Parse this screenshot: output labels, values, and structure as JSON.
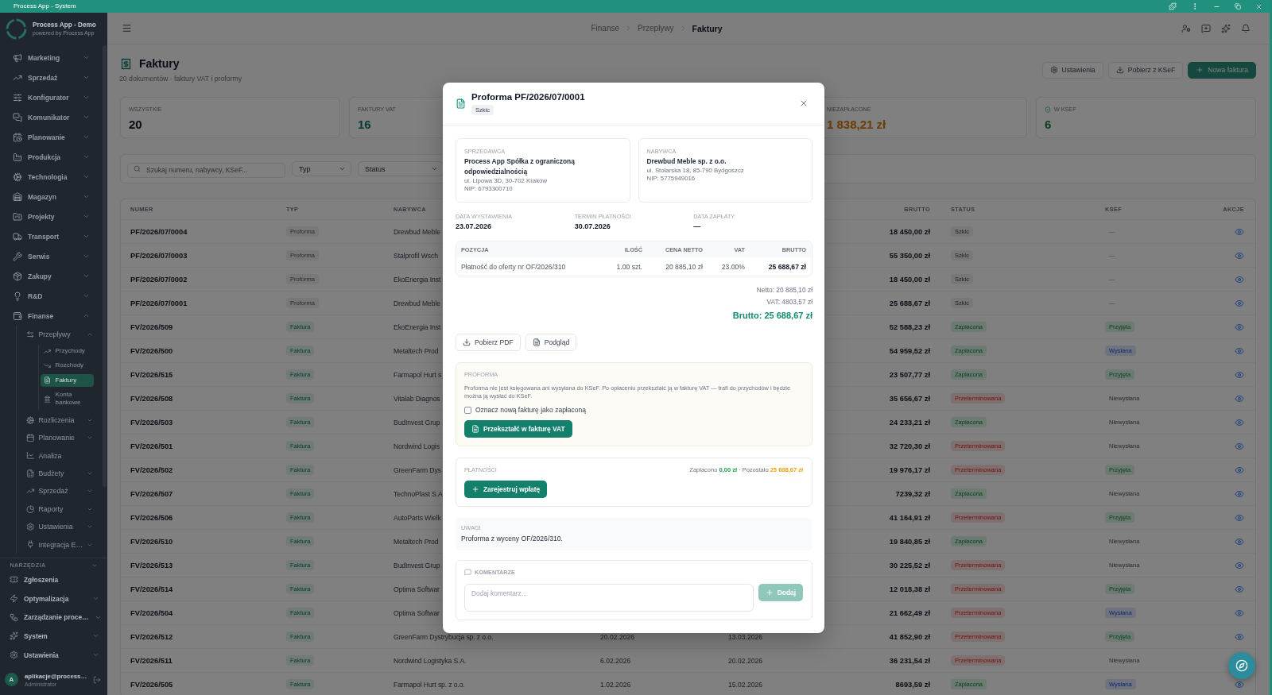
{
  "window": {
    "title": "Process App - System"
  },
  "sidebar": {
    "app_name": "Process App - Demo",
    "app_tagline": "powered by Process App",
    "items": [
      {
        "label": "Marketing",
        "expanded": false,
        "selected": false
      },
      {
        "label": "Sprzedaż",
        "expanded": false,
        "selected": false
      },
      {
        "label": "Konfigurator",
        "expanded": false,
        "selected": false
      },
      {
        "label": "Komunikator",
        "expanded": false,
        "selected": false
      },
      {
        "label": "Planowanie",
        "expanded": false,
        "selected": false
      },
      {
        "label": "Produkcja",
        "expanded": false,
        "selected": false
      },
      {
        "label": "Technologia",
        "expanded": false,
        "selected": false
      },
      {
        "label": "Magazyn",
        "expanded": false,
        "selected": false
      },
      {
        "label": "Projekty",
        "expanded": false,
        "selected": false
      },
      {
        "label": "Transport",
        "expanded": false,
        "selected": false
      },
      {
        "label": "Serwis",
        "expanded": false,
        "selected": false
      },
      {
        "label": "Zakupy",
        "expanded": false,
        "selected": false
      },
      {
        "label": "R&D",
        "expanded": false,
        "selected": false
      },
      {
        "label": "Finanse",
        "expanded": true,
        "selected": false,
        "children": [
          {
            "label": "Przepływy",
            "expanded": true,
            "selected": false,
            "children": [
              {
                "label": "Przychody",
                "selected": false
              },
              {
                "label": "Rozchody",
                "selected": false
              },
              {
                "label": "Faktury",
                "selected": true
              },
              {
                "label": "Konta bankowe",
                "selected": false
              }
            ]
          },
          {
            "label": "Rozliczenia",
            "expanded": false,
            "selected": false
          },
          {
            "label": "Planowanie",
            "expanded": false,
            "selected": false
          },
          {
            "label": "Analiza",
            "selected": false
          },
          {
            "label": "Budżety",
            "expanded": false,
            "selected": false
          },
          {
            "label": "Sprzedaż",
            "expanded": false,
            "selected": false
          },
          {
            "label": "Raporty",
            "expanded": false,
            "selected": false
          },
          {
            "label": "Ustawienia",
            "expanded": false,
            "selected": false
          },
          {
            "label": "Integracja E…",
            "expanded": false,
            "selected": false
          }
        ]
      }
    ],
    "tools": {
      "title": "NARZĘDZIA",
      "expanded": true,
      "items": [
        {
          "label": "Zgłoszenia",
          "selected": false
        },
        {
          "label": "Optymalizacja",
          "expanded": false,
          "selected": false
        },
        {
          "label": "Zarządzanie proce…",
          "expanded": false,
          "selected": false
        },
        {
          "label": "System",
          "expanded": false,
          "selected": false
        },
        {
          "label": "Ustawienia",
          "expanded": false,
          "selected": false
        }
      ]
    },
    "user": {
      "initial": "A",
      "name": "aplikacje@process…",
      "role": "Administrator"
    }
  },
  "topbar": {
    "breadcrumb": [
      {
        "label": "Finanse",
        "current": false
      },
      {
        "label": "Przepływy",
        "current": false
      },
      {
        "label": "Faktury",
        "current": true
      }
    ]
  },
  "page": {
    "title": "Faktury",
    "subtitle": "20 dokumentów · faktury VAT i proformy",
    "actions": [
      {
        "label": "Ustawienia",
        "kind": "settings"
      },
      {
        "label": "Pobierz z KSeF",
        "kind": "download"
      },
      {
        "label": "Nowa faktura",
        "kind": "primary"
      }
    ]
  },
  "stats": [
    {
      "label": "WSZYSTKIE",
      "value": "20",
      "kind": "total"
    },
    {
      "label": "FAKTURY VAT",
      "value": "16",
      "kind": "vat"
    },
    {
      "label": "NIEZAPŁACONE",
      "value": "1 838,21 zł",
      "kind": "unpaid"
    },
    {
      "label": "W KSEF",
      "value": "6",
      "kind": "ksef"
    }
  ],
  "filters": {
    "search": {
      "placeholder": "Szukaj numeru, nabywcy, KSeF..."
    },
    "selects": [
      {
        "value": "Typ"
      },
      {
        "value": "Status"
      }
    ]
  },
  "table": {
    "columns": [
      "NUMER",
      "TYP",
      "NABYWCA",
      "BRUTTO",
      "STATUS",
      "KSEF",
      "AKCJE"
    ],
    "rows": [
      {
        "numer": "PF/2026/07/0004",
        "typ": {
          "label": "Proforma",
          "kind": "proforma"
        },
        "nabywca": "Drewbud Meble",
        "brutto": "18 450,00 zł",
        "status": {
          "label": "Szkic",
          "kind": "draft"
        },
        "ksef": {
          "label": "—",
          "kind": "none"
        }
      },
      {
        "numer": "PF/2026/07/0003",
        "typ": {
          "label": "Proforma",
          "kind": "proforma"
        },
        "nabywca": "Stalprofil Wsch",
        "brutto": "55 350,00 zł",
        "status": {
          "label": "Szkic",
          "kind": "draft"
        },
        "ksef": {
          "label": "—",
          "kind": "none"
        }
      },
      {
        "numer": "PF/2026/07/0002",
        "typ": {
          "label": "Proforma",
          "kind": "proforma"
        },
        "nabywca": "EkoEnergia Inst",
        "brutto": "18 450,00 zł",
        "status": {
          "label": "Szkic",
          "kind": "draft"
        },
        "ksef": {
          "label": "—",
          "kind": "none"
        }
      },
      {
        "numer": "PF/2026/07/0001",
        "typ": {
          "label": "Proforma",
          "kind": "proforma"
        },
        "nabywca": "Drewbud Meble",
        "brutto": "25 688,67 zł",
        "status": {
          "label": "Szkic",
          "kind": "draft"
        },
        "ksef": {
          "label": "—",
          "kind": "none"
        }
      },
      {
        "numer": "FV/2026/509",
        "typ": {
          "label": "Faktura",
          "kind": "invoice"
        },
        "nabywca": "EkoEnergia Inst",
        "brutto": "52 588,23 zł",
        "status": {
          "label": "Zapłacona",
          "kind": "paid"
        },
        "ksef": {
          "label": "Przyjęta",
          "kind": "accepted"
        }
      },
      {
        "numer": "FV/2026/500",
        "typ": {
          "label": "Faktura",
          "kind": "invoice"
        },
        "nabywca": "Metaltech Prod",
        "brutto": "54 959,52 zł",
        "status": {
          "label": "Zapłacona",
          "kind": "paid"
        },
        "ksef": {
          "label": "Wysłana",
          "kind": "sent"
        }
      },
      {
        "numer": "FV/2026/515",
        "typ": {
          "label": "Faktura",
          "kind": "invoice"
        },
        "nabywca": "Farmapol Hurt s",
        "brutto": "23 507,77 zł",
        "status": {
          "label": "Zapłacona",
          "kind": "paid"
        },
        "ksef": {
          "label": "Przyjęta",
          "kind": "accepted"
        }
      },
      {
        "numer": "FV/2026/508",
        "typ": {
          "label": "Faktura",
          "kind": "invoice"
        },
        "nabywca": "Vitalab Diagnos",
        "brutto": "35 656,67 zł",
        "status": {
          "label": "Przeterminowana",
          "kind": "overdue"
        },
        "ksef": {
          "label": "Niewysłana",
          "kind": "not_sent"
        }
      },
      {
        "numer": "FV/2026/503",
        "typ": {
          "label": "Faktura",
          "kind": "invoice"
        },
        "nabywca": "BudInvest Grup",
        "brutto": "24 233,21 zł",
        "status": {
          "label": "Zapłacona",
          "kind": "paid"
        },
        "ksef": {
          "label": "Niewysłana",
          "kind": "not_sent"
        }
      },
      {
        "numer": "FV/2026/501",
        "typ": {
          "label": "Faktura",
          "kind": "invoice"
        },
        "nabywca": "Nordwind Logis",
        "brutto": "32 720,30 zł",
        "status": {
          "label": "Przeterminowana",
          "kind": "overdue"
        },
        "ksef": {
          "label": "Niewysłana",
          "kind": "not_sent"
        }
      },
      {
        "numer": "FV/2026/502",
        "typ": {
          "label": "Faktura",
          "kind": "invoice"
        },
        "nabywca": "GreenFarm Dys",
        "brutto": "19 976,17 zł",
        "status": {
          "label": "Przeterminowana",
          "kind": "overdue"
        },
        "ksef": {
          "label": "Przyjęta",
          "kind": "accepted"
        }
      },
      {
        "numer": "FV/2026/507",
        "typ": {
          "label": "Faktura",
          "kind": "invoice"
        },
        "nabywca": "TechnoPlast S.A",
        "brutto": "7239,32 zł",
        "status": {
          "label": "Zapłacona",
          "kind": "paid"
        },
        "ksef": {
          "label": "Niewysłana",
          "kind": "not_sent"
        }
      },
      {
        "numer": "FV/2026/506",
        "typ": {
          "label": "Faktura",
          "kind": "invoice"
        },
        "nabywca": "AutoParts Wielk",
        "brutto": "41 164,91 zł",
        "status": {
          "label": "Przeterminowana",
          "kind": "overdue"
        },
        "ksef": {
          "label": "Przyjęta",
          "kind": "accepted"
        }
      },
      {
        "numer": "FV/2026/510",
        "typ": {
          "label": "Faktura",
          "kind": "invoice"
        },
        "nabywca": "Metaltech Prod",
        "brutto": "19 840,85 zł",
        "status": {
          "label": "Zapłacona",
          "kind": "paid"
        },
        "ksef": {
          "label": "Niewysłana",
          "kind": "not_sent"
        }
      },
      {
        "numer": "FV/2026/513",
        "typ": {
          "label": "Faktura",
          "kind": "invoice"
        },
        "nabywca": "BudInvest Grup",
        "brutto": "30 225,52 zł",
        "status": {
          "label": "Przeterminowana",
          "kind": "overdue"
        },
        "ksef": {
          "label": "Niewysłana",
          "kind": "not_sent"
        }
      },
      {
        "numer": "FV/2026/514",
        "typ": {
          "label": "Faktura",
          "kind": "invoice"
        },
        "nabywca": "Optima Softwar",
        "brutto": "12 018,38 zł",
        "status": {
          "label": "Przeterminowana",
          "kind": "overdue"
        },
        "ksef": {
          "label": "Przyjęta",
          "kind": "accepted"
        }
      },
      {
        "numer": "FV/2026/504",
        "typ": {
          "label": "Faktura",
          "kind": "invoice"
        },
        "nabywca": "Optima Softwar",
        "brutto": "21 662,49 zł",
        "status": {
          "label": "Przeterminowana",
          "kind": "overdue"
        },
        "ksef": {
          "label": "Wysłana",
          "kind": "sent"
        }
      },
      {
        "numer": "FV/2026/512",
        "typ": {
          "label": "Faktura",
          "kind": "invoice"
        },
        "nabywca": "GreenFarm Dystrybucja sp. z o.o.",
        "column_4": "20.02.2026",
        "column_5": "13.03.2026",
        "brutto": "41 852,90 zł",
        "status": {
          "label": "Przeterminowana",
          "kind": "overdue"
        },
        "ksef": {
          "label": "Przyjęta",
          "kind": "accepted"
        }
      },
      {
        "numer": "FV/2026/511",
        "typ": {
          "label": "Faktura",
          "kind": "invoice"
        },
        "nabywca": "Nordwind Logistyka S.A.",
        "column_4": "6.02.2026",
        "column_5": "20.02.2026",
        "brutto": "36 231,54 zł",
        "status": {
          "label": "Przeterminowana",
          "kind": "overdue"
        },
        "ksef": {
          "label": "Niewysłana",
          "kind": "not_sent"
        }
      },
      {
        "numer": "FV/2026/505",
        "typ": {
          "label": "Faktura",
          "kind": "invoice"
        },
        "nabywca": "Farmapol Hurt sp. z o.o.",
        "column_4": "1.02.2026",
        "column_5": "15.02.2026",
        "brutto": "8693,59 zł",
        "status": {
          "label": "Zapłacona",
          "kind": "paid"
        },
        "ksef": {
          "label": "Wysłana",
          "kind": "sent"
        }
      }
    ]
  },
  "modal": {
    "title": "Proforma PF/2026/07/0001",
    "status": {
      "label": "Szkic",
      "kind": "draft"
    },
    "parties": [
      {
        "label": "SPRZEDAWCA",
        "name": "Process App Spółka z ograniczoną odpowiedzialnością",
        "address": "ul. Lipowa 3D, 30-702 Kraków",
        "tax_id": "NIP: 6793300710"
      },
      {
        "label": "NABYWCA",
        "name": "Drewbud Meble sp. z o.o.",
        "address": "ul. Stolarska 18, 85-790 Bydgoszcz",
        "tax_id": "NIP: 5775949016"
      }
    ],
    "dates": [
      {
        "label": "DATA WYSTAWIENIA",
        "value": "23.07.2026"
      },
      {
        "label": "TERMIN PŁATNOŚCI",
        "value": "30.07.2026"
      },
      {
        "label": "DATA ZAPŁATY",
        "value": "—"
      }
    ],
    "items": {
      "columns": [
        "POZYCJA",
        "ILOŚĆ",
        "CENA NETTO",
        "VAT",
        "BRUTTO"
      ],
      "rows": [
        [
          "Płatność do oferty nr OF/2026/310",
          "1.00 szt.",
          "20 885,10 zł",
          "23.00%",
          "25 688,67 zł"
        ]
      ]
    },
    "totals": [
      {
        "text": "Netto: 20 885,10 zł",
        "kind": "net"
      },
      {
        "text": "VAT: 4803,57 zł",
        "kind": "vat"
      },
      {
        "text": "Brutto: 25 688,67 zł",
        "kind": "gross"
      }
    ],
    "actions": [
      {
        "label": "Pobierz PDF",
        "kind": "download"
      },
      {
        "label": "Podgląd",
        "kind": "preview"
      }
    ],
    "proforma": {
      "title": "PROFORMA",
      "text": "Proforma nie jest księgowana ani wysyłana do KSeF. Po opłaceniu przekształć ją w fakturę VAT — trafi do przychodów i będzie można ją wysłać do KSeF.",
      "checkbox": {
        "label": "Oznacz nową fakturę jako zapłaconą",
        "checked": false
      },
      "button": "Przekształć w fakturę VAT"
    },
    "payments": {
      "title": "PŁATNOŚCI",
      "summary": [
        {
          "text": "Zapłacono",
          "kind": "label"
        },
        {
          "text": "0,00 zł",
          "kind": "paid"
        },
        {
          "text": "·",
          "kind": "label"
        },
        {
          "text": "Pozostało",
          "kind": "label"
        },
        {
          "text": "25 688,67 zł",
          "kind": "remaining"
        }
      ],
      "button": "Zarejestruj wpłatę"
    },
    "notes": {
      "title": "UWAGI",
      "text": "Proforma z wyceny OF/2026/310."
    },
    "comments": {
      "title": "KOMENTARZE",
      "placeholder": "Dodaj komentarz...",
      "button": {
        "label": "Dodaj",
        "disabled": true
      }
    }
  }
}
